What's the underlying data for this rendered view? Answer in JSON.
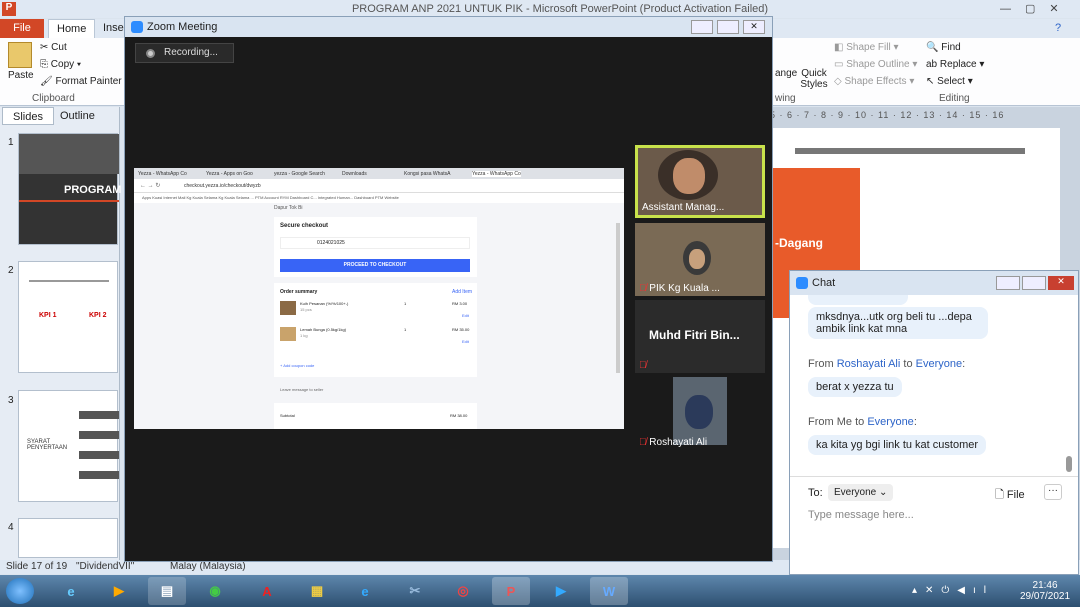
{
  "ppt": {
    "title": "PROGRAM ANP 2021 UNTUK PIK - Microsoft PowerPoint (Product Activation Failed)",
    "tabs": [
      "File",
      "Home",
      "Inser"
    ],
    "clipboard": {
      "paste": "Paste",
      "cut": "Cut",
      "copy": "Copy",
      "format_painter": "Format Painter",
      "group": "Clipboard"
    },
    "drawing": {
      "shape_fill": "Shape Fill",
      "shape_outline": "Shape Outline",
      "shape_effects": "Shape Effects",
      "arrange": "ange",
      "quick_styles": "Quick Styles",
      "group": "wing"
    },
    "editing": {
      "find": "Find",
      "replace": "Replace",
      "select": "Select",
      "group": "Editing"
    },
    "left_tabs": [
      "Slides",
      "Outline"
    ],
    "slide_numbers": [
      "1",
      "2",
      "3",
      "4"
    ],
    "thumb1_title": "PROGRAM",
    "thumb2_kpi": [
      "KPI 1",
      "KPI 2"
    ],
    "thumb3_label": "SYARAT PENYERTAAN",
    "ruler": "5 · 6 · 7 · 8 · 9 · 10 · 11 · 12 · 13 · 14 · 15 · 16",
    "slide_text": "-Dagang",
    "status": {
      "slide": "Slide 17 of 19",
      "theme": "\"DividendVII\"",
      "lang": "Malay (Malaysia)"
    }
  },
  "zoom": {
    "title": "Zoom Meeting",
    "recording": "Recording...",
    "participants": [
      {
        "name": "Assistant Manag...",
        "muted": false,
        "active": true
      },
      {
        "name": "PIK Kg Kuala ...",
        "muted": true,
        "active": false
      },
      {
        "name": "Muhd Fitri Bin...",
        "muted": true,
        "active": false,
        "no_video": true
      },
      {
        "name": "Roshayati Ali",
        "muted": true,
        "active": false
      }
    ],
    "shared": {
      "tabs": [
        "Yezza - WhatsApp Co",
        "Yezza - Apps on Goo",
        "yezza - Google Search",
        "Downloads",
        "Kongsi pasa WhatsA",
        "Yezza - WhatsApp Co"
      ],
      "url": "checkout.yezza.io/checkout/dwyzb",
      "bookmarks": "Apps  Kuasi Internet Mail  Kg Kuala Selama  Kg Kuala Selama ...  PTM Account  RYM Dashboard C...  Integrated Human...  Dashboard  PTM  Website",
      "shop": "Dapur Tok Bi",
      "secure": "Secure checkout",
      "phone": "0124021025",
      "cta": "PROCEED TO CHECKOUT",
      "summary": "Order summary",
      "add_item": "Add Item",
      "items": [
        {
          "name": "Kuih Pesanan (%/%/100+-)",
          "sub": "15 pcs",
          "qty": "1",
          "price": "RM 3.00"
        },
        {
          "name": "Lemah Bunga (0.5kg/1kg)",
          "sub": "1 kg",
          "qty": "1",
          "price": "RM 35.00"
        }
      ],
      "edit": "Edit",
      "coupon": "+ Add coupon code",
      "message": "Leave message to seller",
      "subtotal": "Subtotal",
      "subtotal_val": "RM 38.00"
    }
  },
  "chat": {
    "title": "Chat",
    "messages": [
      {
        "text": "mksdnya...utk org beli tu ...depa ambik link kat mna"
      },
      {
        "from": "Roshayati Ali",
        "to": "Everyone",
        "text": "berat x yezza tu"
      },
      {
        "from": "Me",
        "to": "Everyone",
        "text": "ka kita yg bgi link tu kat customer"
      }
    ],
    "from_label": "From",
    "to_label": "to",
    "to_prefix": "To:",
    "to_value": "Everyone",
    "file": "File",
    "placeholder": "Type message here..."
  },
  "clock": {
    "time": "21:46",
    "date": "29/07/2021"
  }
}
